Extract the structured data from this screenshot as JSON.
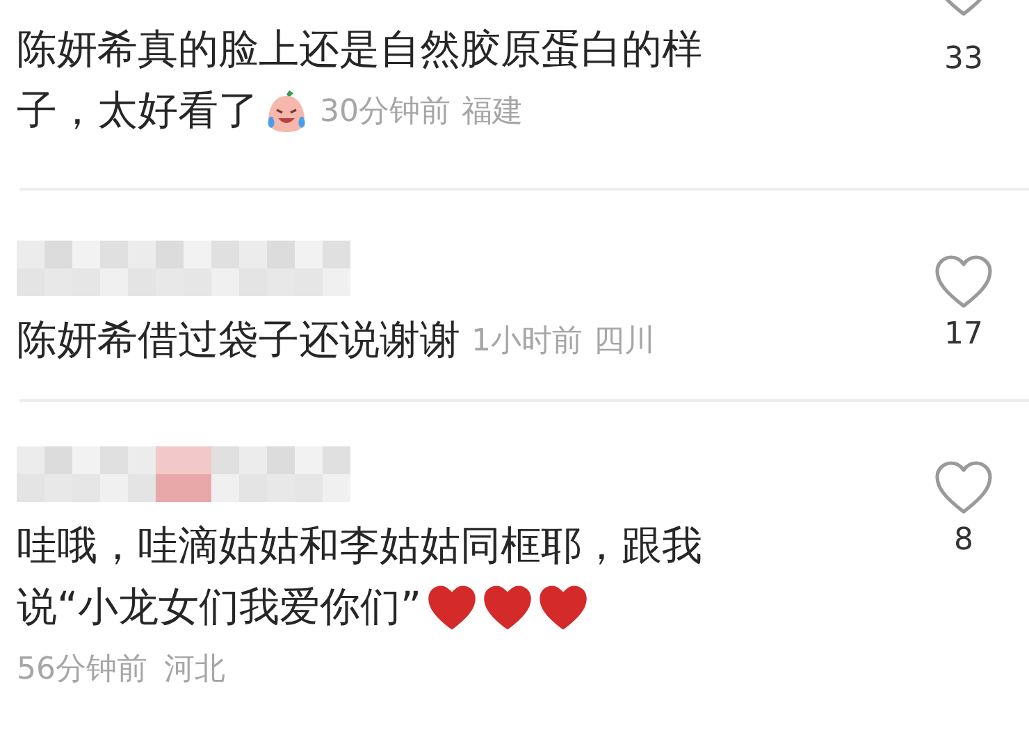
{
  "comments": [
    {
      "kind": "emoji-inline",
      "lines": [
        "陈妍希真的脸上还是自然胶原蛋白的样",
        "子，太好看了"
      ],
      "time": "30分钟前",
      "region": "福建",
      "likes": "33"
    },
    {
      "kind": "plain",
      "lines": [
        "陈妍希借过袋子还说谢谢"
      ],
      "time": "1小时前",
      "region": "四川",
      "likes": "17"
    },
    {
      "kind": "hearts-meta-below",
      "lines": [
        "哇哦，哇滴姑姑和李姑姑同框耶，跟我",
        "说“小龙女们我爱你们”"
      ],
      "time": "56分钟前",
      "region": "河北",
      "likes": "8"
    }
  ]
}
